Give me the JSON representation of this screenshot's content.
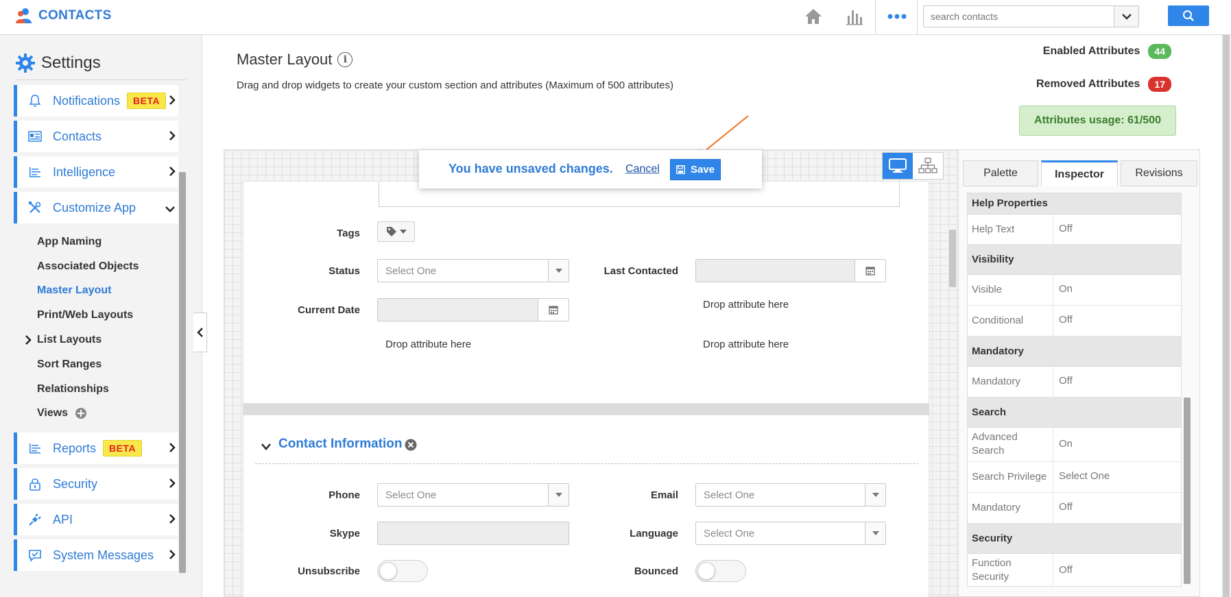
{
  "app": {
    "title": "CONTACTS"
  },
  "search": {
    "placeholder": "search contacts"
  },
  "sidebar": {
    "title": "Settings",
    "items": [
      {
        "label": "Notifications",
        "badge": "BETA",
        "icon": "bell-icon"
      },
      {
        "label": "Contacts",
        "icon": "contacts-card-icon"
      },
      {
        "label": "Intelligence",
        "icon": "list-lines-icon"
      },
      {
        "label": "Customize App",
        "icon": "tools-icon"
      },
      {
        "label": "Reports",
        "badge": "BETA",
        "icon": "report-lines-icon"
      },
      {
        "label": "Security",
        "icon": "lock-icon"
      },
      {
        "label": "API",
        "icon": "plug-icon"
      },
      {
        "label": "System Messages",
        "icon": "message-check-icon"
      }
    ],
    "subitems": [
      "App Naming",
      "Associated Objects",
      "Master Layout",
      "Print/Web Layouts",
      "List Layouts",
      "Sort Ranges",
      "Relationships",
      "Views"
    ],
    "active_subitem": "Master Layout"
  },
  "page": {
    "title": "Master Layout",
    "description": "Drag and drop widgets to create your custom section and attributes (Maximum of 500 attributes)"
  },
  "stats": {
    "enabled_label": "Enabled Attributes",
    "enabled_count": "44",
    "removed_label": "Removed Attributes",
    "removed_count": "17",
    "usage": "Attributes usage: 61/500"
  },
  "banner": {
    "message": "You have unsaved changes.",
    "cancel": "Cancel",
    "save": "Save"
  },
  "form": {
    "tags_label": "Tags",
    "status_label": "Status",
    "status_placeholder": "Select One",
    "last_contacted_label": "Last Contacted",
    "current_date_label": "Current Date",
    "drop_text": "Drop attribute here",
    "section_title": "Contact Information",
    "phone_label": "Phone",
    "phone_placeholder": "Select One",
    "email_label": "Email",
    "email_placeholder": "Select One",
    "skype_label": "Skype",
    "language_label": "Language",
    "language_placeholder": "Select One",
    "unsubscribe_label": "Unsubscribe",
    "bounced_label": "Bounced"
  },
  "inspector": {
    "tabs": [
      "Palette",
      "Inspector",
      "Revisions"
    ],
    "active_tab": "Inspector",
    "sections": [
      {
        "header": "Help Properties",
        "rows": [
          {
            "key": "Help Text",
            "value": "Off"
          }
        ]
      },
      {
        "header": "Visibility",
        "rows": [
          {
            "key": "Visible",
            "value": "On"
          },
          {
            "key": "Conditional",
            "value": "Off"
          }
        ]
      },
      {
        "header": "Mandatory",
        "rows": [
          {
            "key": "Mandatory",
            "value": "Off"
          }
        ]
      },
      {
        "header": "Search",
        "rows": [
          {
            "key": "Advanced Search",
            "value": "On"
          },
          {
            "key": "Search Privilege",
            "value": "Select One"
          },
          {
            "key": "Mandatory",
            "value": "Off"
          }
        ]
      },
      {
        "header": "Security",
        "rows": [
          {
            "key": "Function Security",
            "value": "Off"
          }
        ]
      }
    ]
  },
  "colors": {
    "accent": "#2f86e8",
    "brand_text": "#2f7bd6",
    "enabled_pill": "#5cb85c",
    "removed_pill": "#d9332e",
    "beta_bg": "#f9e84a",
    "usage_bg": "#d5efcd"
  }
}
